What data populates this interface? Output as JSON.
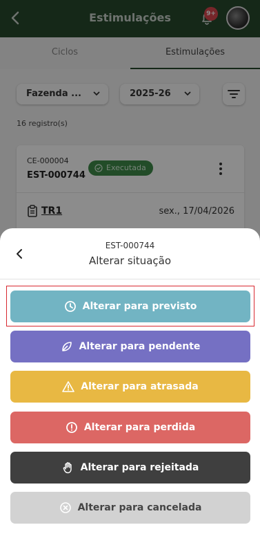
{
  "header": {
    "title": "Estimulações",
    "notification_badge": "9+"
  },
  "tabs": [
    {
      "label": "Ciclos",
      "active": false
    },
    {
      "label": "Estimulações",
      "active": true
    }
  ],
  "filters": {
    "farm": "Fazenda ...",
    "season": "2025-26"
  },
  "record_count": "16 registro(s)",
  "card": {
    "code": "CE-000004",
    "id": "EST-000744",
    "status": "Executada",
    "tr_label": "TR1",
    "date": "sex., 17/04/2026"
  },
  "sheet": {
    "code": "EST-000744",
    "title": "Alterar situação",
    "actions": [
      {
        "label": "Alterar para previsto",
        "icon": "clock-icon",
        "color": "#72b4c3"
      },
      {
        "label": "Alterar para pendente",
        "icon": "leaf-icon",
        "color": "#7570c3"
      },
      {
        "label": "Alterar para atrasada",
        "icon": "warning-icon",
        "color": "#e8b843"
      },
      {
        "label": "Alterar para perdida",
        "icon": "alert-circle-icon",
        "color": "#dc6764"
      },
      {
        "label": "Alterar para rejeitada",
        "icon": "hand-icon",
        "color": "#3f3f3f"
      },
      {
        "label": "Alterar para cancelada",
        "icon": "x-circle-icon",
        "color": "#d2d2d2"
      }
    ]
  },
  "colors": {
    "header": "#27492d",
    "status_executada": "#3f8a4a",
    "highlight_border": "#d8272f"
  }
}
